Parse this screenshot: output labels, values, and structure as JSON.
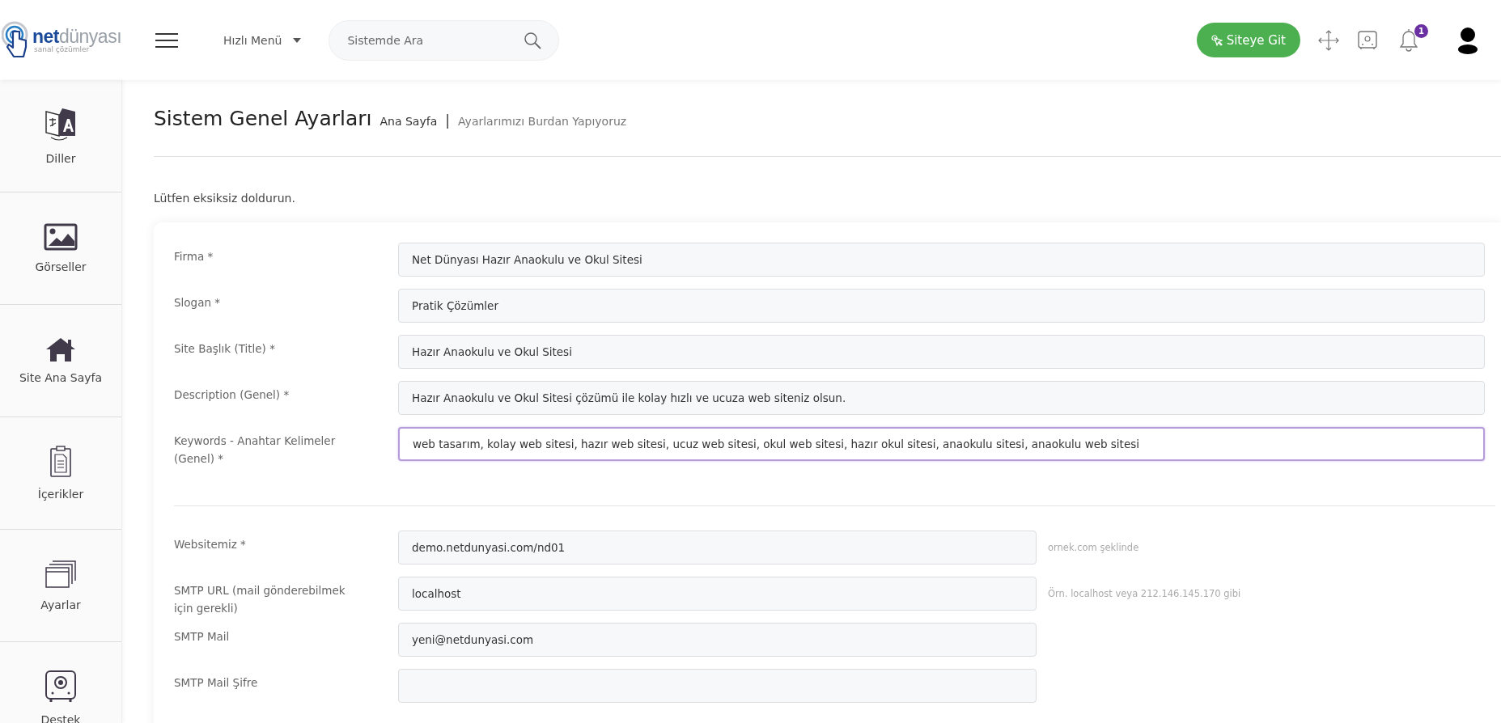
{
  "logo": {
    "name": "**net**dünyası",
    "tagline": "sanal çözümler"
  },
  "header": {
    "quick_menu": "Hızlı Menü",
    "search": {
      "placeholder": "Sistemde Ara"
    },
    "site_button": "Siteye Git",
    "notification_count": "1"
  },
  "sidebar": {
    "items": [
      {
        "label": "Diller",
        "kind": "languages"
      },
      {
        "label": "Görseller",
        "kind": "images"
      },
      {
        "label": "Site Ana Sayfa",
        "kind": "home"
      },
      {
        "label": "İçerikler",
        "kind": "contents"
      },
      {
        "label": "Ayarlar",
        "kind": "settings"
      },
      {
        "label": "Destek",
        "kind": "support"
      }
    ]
  },
  "page": {
    "title": "Sistem Genel Ayarları",
    "breadcrumb": [
      "Ana Sayfa",
      "Ayarlarımızı Burdan Yapıyoruz"
    ],
    "separator": "|",
    "intro": "Lütfen eksiksiz doldurun."
  },
  "form": {
    "sections": [
      {
        "fields": [
          {
            "label": "Firma *",
            "value": "Net Dünyası Hazır Anaokulu ve Okul Sitesi",
            "focused": false
          },
          {
            "label": "Slogan *",
            "value": "Pratik Çözümler",
            "focused": false
          },
          {
            "label": "Site Başlık (Title) *",
            "value": "Hazır Anaokulu ve Okul Sitesi",
            "focused": false
          },
          {
            "label": "Description (Genel) *",
            "value": "Hazır Anaokulu ve Okul Sitesi çözümü ile kolay hızlı ve ucuza web siteniz olsun.",
            "focused": false
          },
          {
            "label": "Keywords - Anahtar Kelimeler (Genel) *",
            "value": "web tasarım, kolay web sitesi, hazır web sitesi, ucuz web sitesi, okul web sitesi, hazır okul sitesi, anaokulu sitesi, anaokulu web sitesi",
            "focused": true
          }
        ]
      },
      {
        "fields": [
          {
            "label": "Websitemiz *",
            "value": "demo.netdunyasi.com/nd01",
            "hint": "ornek.com şeklinde",
            "focused": false
          },
          {
            "label": "SMTP URL (mail gönderebilmek için gerekli)",
            "value": "localhost",
            "hint": "Örn. localhost veya 212.146.145.170 gibi",
            "focused": false
          },
          {
            "label": "SMTP Mail",
            "value": "yeni@netdunyasi.com",
            "focused": false
          },
          {
            "label": "SMTP Mail Şifre",
            "focused": false
          }
        ]
      }
    ]
  }
}
